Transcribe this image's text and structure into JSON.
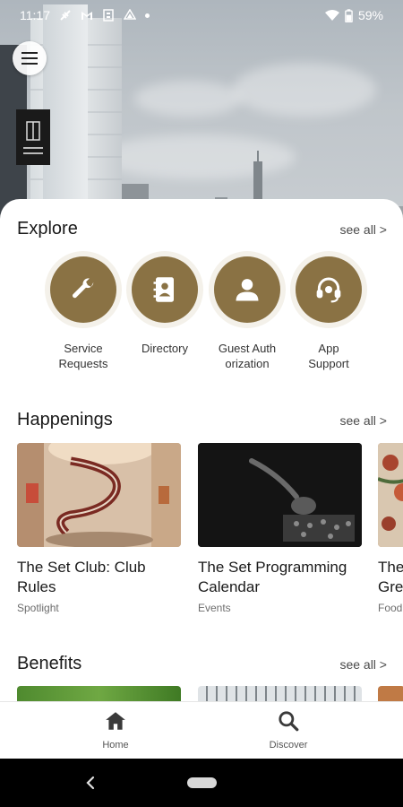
{
  "status_bar": {
    "time": "11:17",
    "battery": "59%"
  },
  "explore": {
    "title": "Explore",
    "see_all": "see all >",
    "items": [
      {
        "label": "Service\nRequests",
        "icon": "wrench-icon"
      },
      {
        "label": "Directory",
        "icon": "contact-book-icon"
      },
      {
        "label": "Guest Auth\norization",
        "icon": "person-icon"
      },
      {
        "label": "App\nSupport",
        "icon": "headset-icon"
      }
    ]
  },
  "happenings": {
    "title": "Happenings",
    "see_all": "see all >",
    "cards": [
      {
        "title_line1": "The Set Club: Club",
        "title_line2": "Rules",
        "category": "Spotlight"
      },
      {
        "title_line1": "The Set Programming",
        "title_line2": "Calendar",
        "category": "Events"
      },
      {
        "title_line1": "The",
        "title_line2": "Gre",
        "category": "Food"
      }
    ]
  },
  "benefits": {
    "title": "Benefits",
    "see_all": "see all >"
  },
  "bottom_nav": {
    "home": "Home",
    "discover": "Discover"
  },
  "colors": {
    "accent": "#8a7244",
    "accent_halo": "#f4f1ea",
    "nav_icon": "#3a3a3a"
  }
}
